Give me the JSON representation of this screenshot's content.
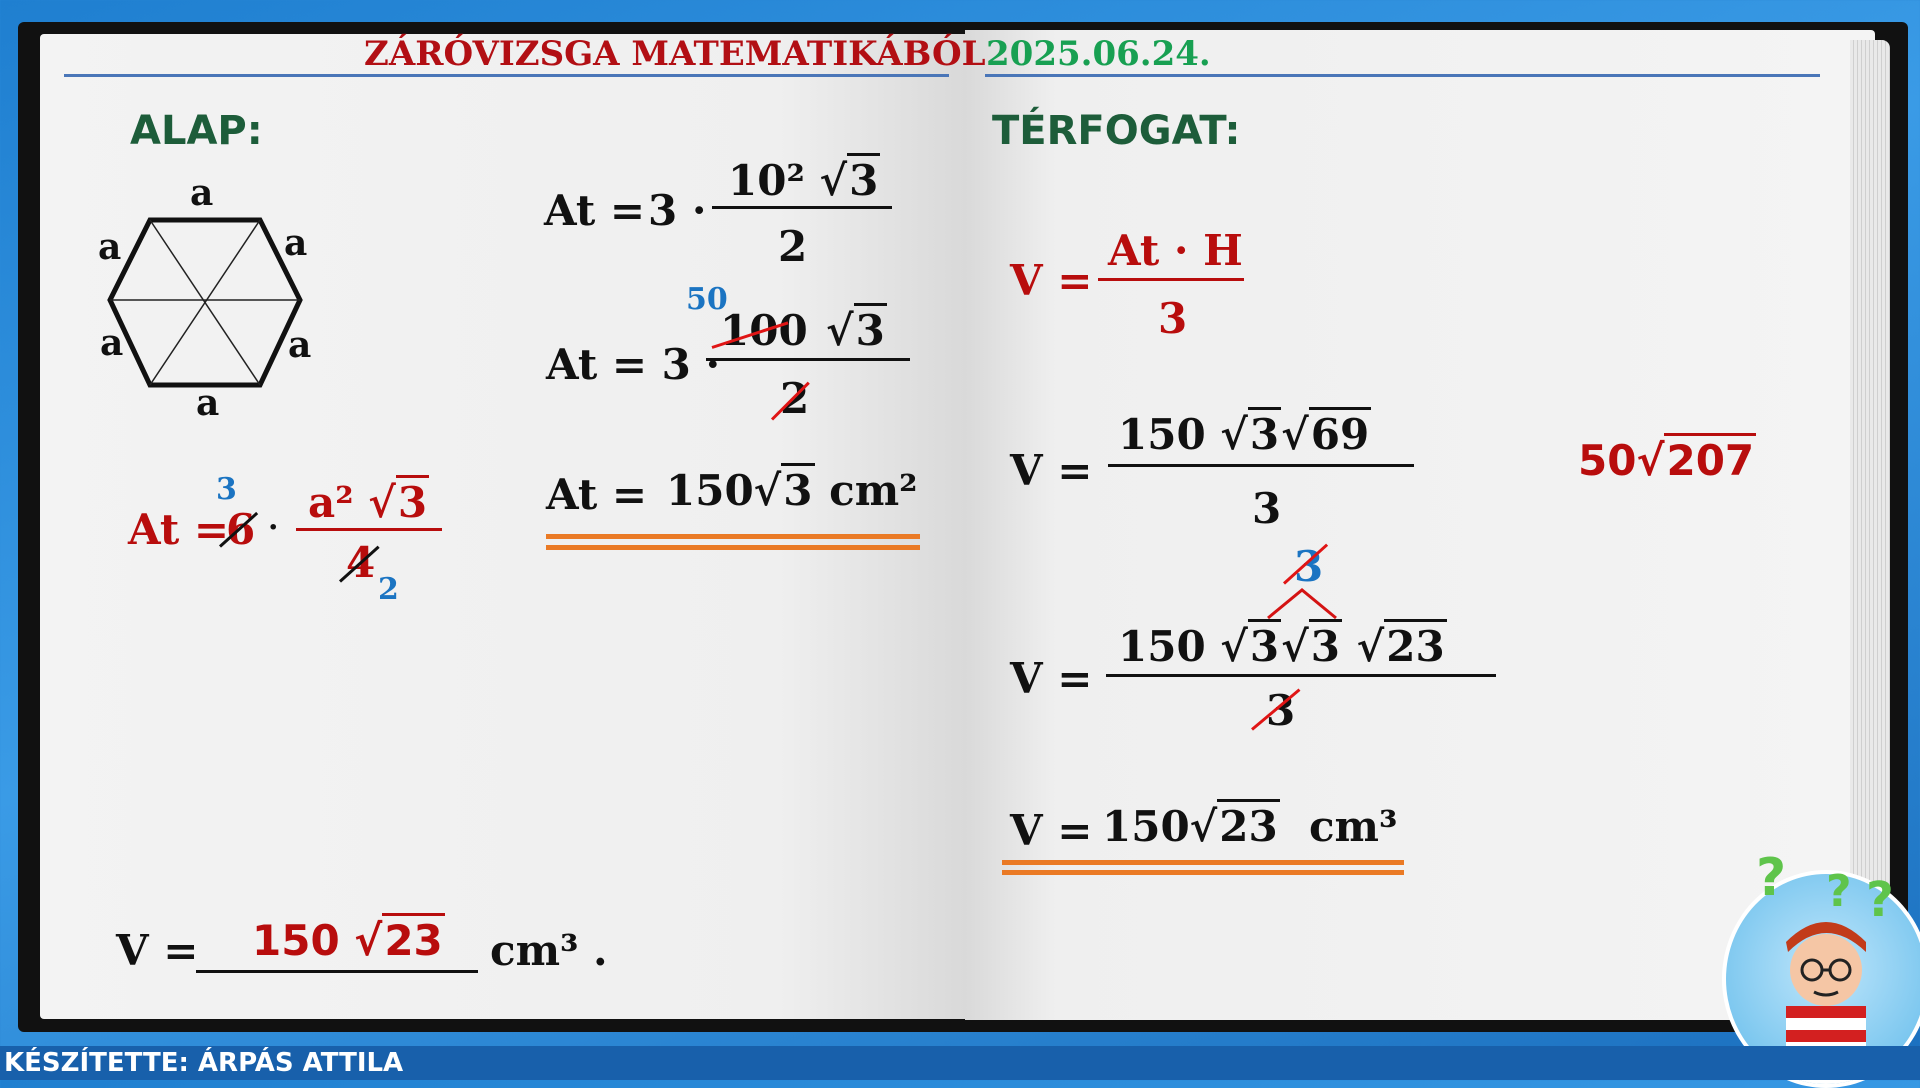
{
  "header": {
    "title": "ZÁRÓVIZSGA MATEMATIKÁBÓL",
    "date": "2025.06.24."
  },
  "left_page": {
    "heading": "ALAP:",
    "hexagon_labels": [
      "a",
      "a",
      "a",
      "a",
      "a",
      "a"
    ],
    "formula_base": {
      "lhs": "At =",
      "coef_crossed": "6",
      "coef_new": "3",
      "dot": "·",
      "num_a": "a²",
      "num_root": "3",
      "den_crossed": "4",
      "den_new": "2"
    },
    "step1": {
      "lhs": "At =",
      "coef": "3 ·",
      "num_a": "10²",
      "num_root": "3",
      "den": "2"
    },
    "step2": {
      "lhs": "At = 3 ·",
      "num_new": "50",
      "num_crossed": "100",
      "num_root": "3",
      "den_crossed": "2"
    },
    "step3": {
      "lhs": "At =",
      "value": "150",
      "root": "3",
      "unit": "cm²"
    },
    "answer": {
      "lhs": "V =",
      "value": "150",
      "root": "23",
      "unit": "cm³ ."
    }
  },
  "right_page": {
    "heading": "TÉRFOGAT:",
    "formula": {
      "lhs": "V =",
      "num": "At · H",
      "den": "3"
    },
    "eq1": {
      "lhs": "V =",
      "coef": "150",
      "root1": "3",
      "root2": "69",
      "den": "3"
    },
    "side_note": {
      "coef": "50",
      "root": "207"
    },
    "eq2": {
      "lhs": "V =",
      "split_crossed": "3",
      "coef": "150",
      "root1": "3",
      "root2": "3",
      "root3": "23",
      "den_crossed": "3"
    },
    "result": {
      "lhs": "V =",
      "coef": "150",
      "root": "23",
      "unit": "cm³"
    }
  },
  "footer": {
    "credit": "KÉSZÍTETTE: ÁRPÁS ATTILA"
  },
  "colors": {
    "title": "#b20f14",
    "date": "#18a052",
    "heading": "#1d5d3a",
    "accent_red": "#b80d0d",
    "accent_blue": "#1b74c2",
    "underline": "#ea7a25",
    "background": "#2a8ddb"
  },
  "icons": [
    "hexagon-diagram-icon",
    "thinking-character-icon"
  ]
}
